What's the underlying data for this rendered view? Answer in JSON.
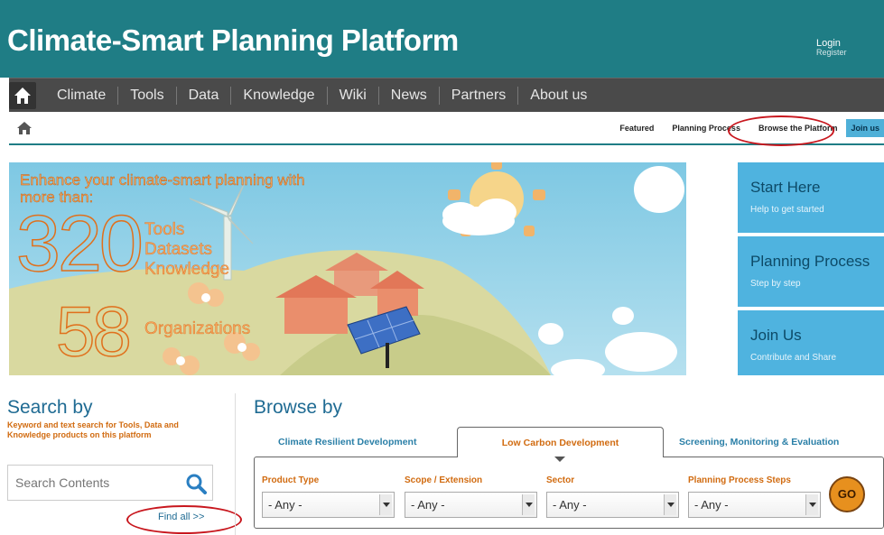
{
  "header": {
    "title": "Climate-Smart Planning Platform",
    "login": "Login",
    "register": "Register"
  },
  "nav": {
    "home_icon": "home-icon",
    "items": [
      "Climate",
      "Tools",
      "Data",
      "Knowledge",
      "Wiki",
      "News",
      "Partners",
      "About us"
    ]
  },
  "subnav": {
    "home_icon": "home-icon",
    "featured": "Featured",
    "planning_process": "Planning Process",
    "browse": "Browse the Platform",
    "join": "Join us"
  },
  "banner": {
    "lead": "Enhance your climate-smart planning with more than:",
    "count_1": "320",
    "lines": [
      "Tools",
      "Datasets",
      "Knowledge"
    ],
    "count_2": "58",
    "organizations": "Organizations"
  },
  "side_panels": [
    {
      "title": "Start Here",
      "subtitle": "Help to get started"
    },
    {
      "title": "Planning Process",
      "subtitle": "Step by step"
    },
    {
      "title": "Join Us",
      "subtitle": "Contribute and Share"
    }
  ],
  "search": {
    "title": "Search by",
    "description": "Keyword and text search for Tools, Data and Knowledge products on this platform",
    "placeholder": "Search Contents",
    "find_all": "Find all >>"
  },
  "browse": {
    "title": "Browse by",
    "tabs": [
      "Climate Resilient Development",
      "Low Carbon Development",
      "Screening, Monitoring & Evaluation"
    ],
    "active_tab": "Low Carbon Development",
    "filters": [
      {
        "label": "Product Type",
        "value": "- Any -"
      },
      {
        "label": "Scope / Extension",
        "value": "- Any -"
      },
      {
        "label": "Sector",
        "value": "- Any -"
      },
      {
        "label": "Planning Process Steps",
        "value": "- Any -"
      }
    ],
    "go": "GO"
  },
  "colors": {
    "header": "#1f7d85",
    "nav": "#4a4a4a",
    "side_panel": "#4fb3df",
    "accent_orange": "#d16b10",
    "annotation_red": "#c8171e"
  }
}
